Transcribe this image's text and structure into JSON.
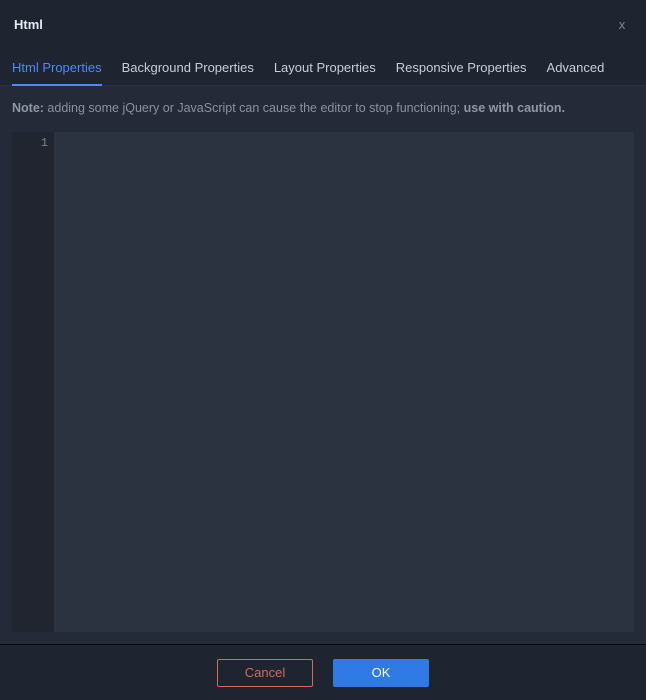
{
  "title": "Html",
  "tabs": [
    {
      "label": "Html Properties",
      "active": true
    },
    {
      "label": "Background Properties",
      "active": false
    },
    {
      "label": "Layout Properties",
      "active": false
    },
    {
      "label": "Responsive Properties",
      "active": false
    },
    {
      "label": "Advanced",
      "active": false
    }
  ],
  "note": {
    "prefix": "Note:",
    "body": " adding some jQuery or JavaScript can cause the editor to stop functioning; ",
    "suffix": "use with caution."
  },
  "editor": {
    "line_numbers": [
      "1"
    ],
    "content": ""
  },
  "footer": {
    "cancel": "Cancel",
    "ok": "OK"
  }
}
